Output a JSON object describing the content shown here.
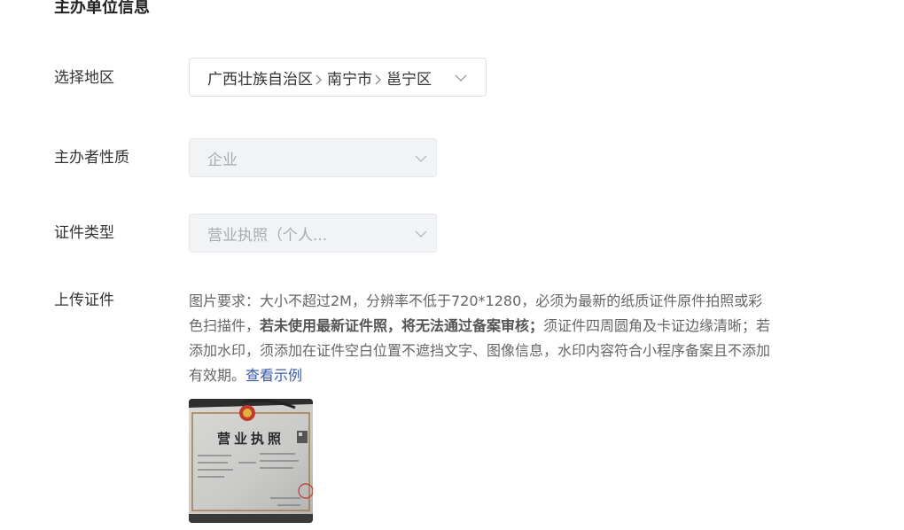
{
  "section": {
    "title": "主办单位信息"
  },
  "region": {
    "label": "选择地区",
    "province": "广西壮族自治区",
    "city": "南宁市",
    "district": "邕宁区"
  },
  "sponsor_type": {
    "label": "主办者性质",
    "value": "企业"
  },
  "cert_type": {
    "label": "证件类型",
    "value": "营业执照（个人..."
  },
  "upload": {
    "label": "上传证件",
    "desc_part1": "图片要求：大小不超过2M，分辨率不低于720*1280，必须为最新的纸质证件原件拍照或彩色扫描件，",
    "desc_bold": "若未使用最新证件照，将无法通过备案审核；",
    "desc_part2": "须证件四周圆角及卡证边缘清晰；若添加水印，须添加在证件空白位置不遮挡文字、图像信息，水印内容符合小程序备案且不添加有效期。",
    "example_link": "查看示例",
    "thumb_title": "营业执照"
  },
  "colors": {
    "link": "#3a5aa8",
    "disabled_bg": "#f2f3f5",
    "border": "#dcdfe6",
    "seal_red": "#c0392b"
  },
  "icons": {
    "select_arrow": "chevron-down-icon",
    "region_separator": "chevron-right-icon"
  }
}
